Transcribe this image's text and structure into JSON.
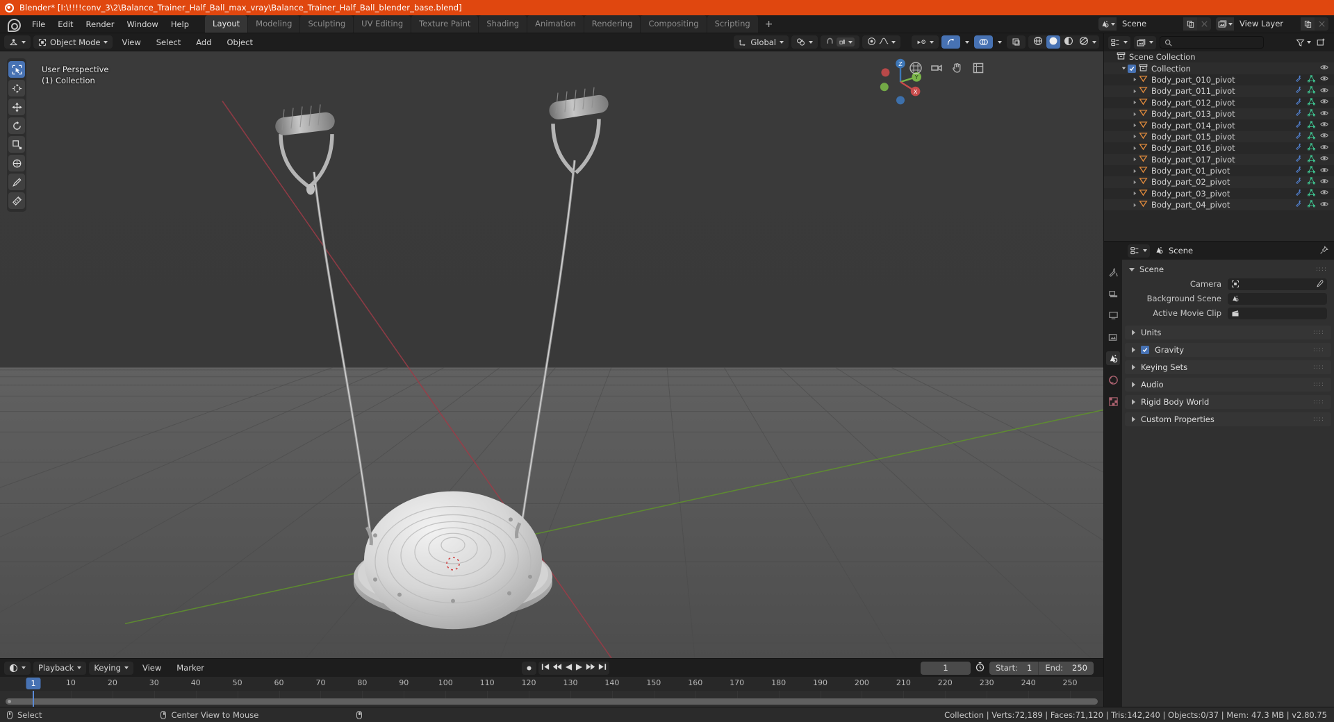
{
  "titlebar": {
    "text": "Blender* [I:\\!!!!conv_3\\2\\Balance_Trainer_Half_Ball_max_vray\\Balance_Trainer_Half_Ball_blender_base.blend]",
    "icon": "blender-logo-icon",
    "bg": "#e0470f"
  },
  "topbar": {
    "menus": [
      "File",
      "Edit",
      "Render",
      "Window",
      "Help"
    ],
    "workspaces": [
      {
        "label": "Layout",
        "active": true
      },
      {
        "label": "Modeling",
        "active": false
      },
      {
        "label": "Sculpting",
        "active": false
      },
      {
        "label": "UV Editing",
        "active": false
      },
      {
        "label": "Texture Paint",
        "active": false
      },
      {
        "label": "Shading",
        "active": false
      },
      {
        "label": "Animation",
        "active": false
      },
      {
        "label": "Rendering",
        "active": false
      },
      {
        "label": "Compositing",
        "active": false
      },
      {
        "label": "Scripting",
        "active": false
      }
    ],
    "add_workspace_label": "+",
    "scene": {
      "name": "Scene",
      "icon": "scene-icon",
      "new_label": "new-scene-icon",
      "unlink_label": "x"
    },
    "view_layer": {
      "name": "View Layer",
      "icon": "view-layer-icon",
      "new_label": "new-layer-icon",
      "unlink_label": "x"
    }
  },
  "viewport": {
    "header": {
      "editor_type": "editor-type-icon",
      "mode": "Object Mode",
      "menus": [
        "View",
        "Select",
        "Add",
        "Object"
      ],
      "transform_orientation": "Global",
      "pivot_icon": "pivot-point-icon",
      "snap_icon": "snap-magnet-icon",
      "snap_target": "snap-increment-icon",
      "proportional_icon": "proportional-editing-icon",
      "falloff_icon": "smooth-falloff-icon",
      "visibility_icon": "visibility-icon",
      "gizmo_icon": "gizmo-icon",
      "overlays_icon": "overlays-icon",
      "xray_icon": "xray-icon",
      "shading_modes": [
        "wireframe",
        "solid",
        "material-preview",
        "rendered"
      ],
      "shading_active": "solid"
    },
    "overlay": {
      "line1": "User Perspective",
      "line2": "(1) Collection"
    },
    "tools": [
      "select-box-tool",
      "cursor-tool",
      "move-tool",
      "rotate-tool",
      "scale-tool",
      "transform-tool",
      "annotate-tool",
      "measure-tool"
    ],
    "gizmo": {
      "x": "X",
      "y": "Y",
      "z": "Z"
    },
    "nav_icons": [
      "zoom-icon",
      "move-view-icon",
      "camera-view-icon",
      "toggle-ortho-icon"
    ]
  },
  "timeline": {
    "editor_icon": "timeline-editor-icon",
    "menus": [
      "Playback",
      "Keying",
      "View",
      "Marker"
    ],
    "transport": [
      "jump-to-start",
      "jump-prev-keyframe",
      "play-reverse",
      "play",
      "jump-next-keyframe",
      "jump-to-end"
    ],
    "record_icon": "record-icon",
    "current_frame": "1",
    "auto_key_icon": "auto-keying-icon",
    "start_label": "Start:",
    "start_value": "1",
    "end_label": "End:",
    "end_value": "250",
    "tick_labels": [
      "10",
      "20",
      "30",
      "40",
      "50",
      "60",
      "70",
      "80",
      "90",
      "100",
      "110",
      "120",
      "130",
      "140",
      "150",
      "160",
      "170",
      "180",
      "190",
      "200",
      "210",
      "220",
      "230",
      "240",
      "250"
    ],
    "tick_frames": [
      10,
      20,
      30,
      40,
      50,
      60,
      70,
      80,
      90,
      100,
      110,
      120,
      130,
      140,
      150,
      160,
      170,
      180,
      190,
      200,
      210,
      220,
      230,
      240,
      250
    ],
    "playhead_frame": 1,
    "frame_range": [
      1,
      255
    ]
  },
  "outliner": {
    "display_mode_icon": "outliner-display-mode-icon",
    "filter_scene_icon": "scene-filter-icon",
    "search_placeholder": "",
    "search_icon": "search-icon",
    "filter_icon": "filter-icon",
    "new_collection_icon": "new-collection-icon",
    "rows": [
      {
        "label": "Scene Collection",
        "depth": 0,
        "icon": "scene-collection-icon",
        "disclosure": "",
        "checkbox": false,
        "eye": false,
        "modifier": false
      },
      {
        "label": "Collection",
        "depth": 1,
        "icon": "collection-icon",
        "disclosure": "down",
        "checkbox": true,
        "eye": true,
        "modifier": false
      },
      {
        "label": "Body_part_010_pivot",
        "depth": 2,
        "icon": "empty-icon",
        "disclosure": "right",
        "checkbox": false,
        "eye": true,
        "modifier": true
      },
      {
        "label": "Body_part_011_pivot",
        "depth": 2,
        "icon": "empty-icon",
        "disclosure": "right",
        "checkbox": false,
        "eye": true,
        "modifier": true
      },
      {
        "label": "Body_part_012_pivot",
        "depth": 2,
        "icon": "empty-icon",
        "disclosure": "right",
        "checkbox": false,
        "eye": true,
        "modifier": true
      },
      {
        "label": "Body_part_013_pivot",
        "depth": 2,
        "icon": "empty-icon",
        "disclosure": "right",
        "checkbox": false,
        "eye": true,
        "modifier": true
      },
      {
        "label": "Body_part_014_pivot",
        "depth": 2,
        "icon": "empty-icon",
        "disclosure": "right",
        "checkbox": false,
        "eye": true,
        "modifier": true
      },
      {
        "label": "Body_part_015_pivot",
        "depth": 2,
        "icon": "empty-icon",
        "disclosure": "right",
        "checkbox": false,
        "eye": true,
        "modifier": true
      },
      {
        "label": "Body_part_016_pivot",
        "depth": 2,
        "icon": "empty-icon",
        "disclosure": "right",
        "checkbox": false,
        "eye": true,
        "modifier": true
      },
      {
        "label": "Body_part_017_pivot",
        "depth": 2,
        "icon": "empty-icon",
        "disclosure": "right",
        "checkbox": false,
        "eye": true,
        "modifier": true
      },
      {
        "label": "Body_part_01_pivot",
        "depth": 2,
        "icon": "empty-icon",
        "disclosure": "right",
        "checkbox": false,
        "eye": true,
        "modifier": true
      },
      {
        "label": "Body_part_02_pivot",
        "depth": 2,
        "icon": "empty-icon",
        "disclosure": "right",
        "checkbox": false,
        "eye": true,
        "modifier": true
      },
      {
        "label": "Body_part_03_pivot",
        "depth": 2,
        "icon": "empty-icon",
        "disclosure": "right",
        "checkbox": false,
        "eye": true,
        "modifier": true
      },
      {
        "label": "Body_part_04_pivot",
        "depth": 2,
        "icon": "empty-icon",
        "disclosure": "right",
        "checkbox": false,
        "eye": true,
        "modifier": true
      }
    ]
  },
  "properties": {
    "breadcrumb_icon": "scene-properties-icon",
    "breadcrumb": "Scene",
    "pin_icon": "pin-icon",
    "editor_icon": "properties-editor-icon",
    "tabs": [
      {
        "name": "tool-properties-tab",
        "active": false
      },
      {
        "name": "render-properties-tab",
        "active": false
      },
      {
        "name": "output-properties-tab",
        "active": false
      },
      {
        "name": "view-layer-properties-tab",
        "active": false
      },
      {
        "name": "scene-properties-tab",
        "active": true
      },
      {
        "name": "world-properties-tab",
        "active": false
      },
      {
        "name": "texture-properties-tab",
        "active": false
      }
    ],
    "panel_title": "Scene",
    "fields": [
      {
        "label": "Camera",
        "value": "",
        "icon": "camera-icon",
        "eyedropper": true
      },
      {
        "label": "Background Scene",
        "value": "",
        "icon": "scene-icon",
        "eyedropper": false
      },
      {
        "label": "Active Movie Clip",
        "value": "",
        "icon": "movie-clip-icon",
        "eyedropper": false
      }
    ],
    "sections": [
      {
        "label": "Units",
        "checkbox": false
      },
      {
        "label": "Gravity",
        "checkbox": true
      },
      {
        "label": "Keying Sets",
        "checkbox": false
      },
      {
        "label": "Audio",
        "checkbox": false
      },
      {
        "label": "Rigid Body World",
        "checkbox": false
      },
      {
        "label": "Custom Properties",
        "checkbox": false
      }
    ]
  },
  "statusbar": {
    "items": [
      {
        "icon": "mouse-left-icon",
        "label": "Select"
      },
      {
        "icon": "mouse-middle-icon",
        "label": "Center View to Mouse"
      },
      {
        "icon": "mouse-right-icon",
        "label": ""
      }
    ],
    "stats": "Collection | Verts:72,189 | Faces:71,120 | Tris:142,240 | Objects:0/37 | Mem: 47.3 MB | v2.80.75"
  },
  "colors": {
    "accent": "#4772b3",
    "brand_orange": "#e0470f",
    "empty_orange": "#e08a3c",
    "mesh_green": "#3ec490",
    "modifier_blue": "#5588dd"
  }
}
